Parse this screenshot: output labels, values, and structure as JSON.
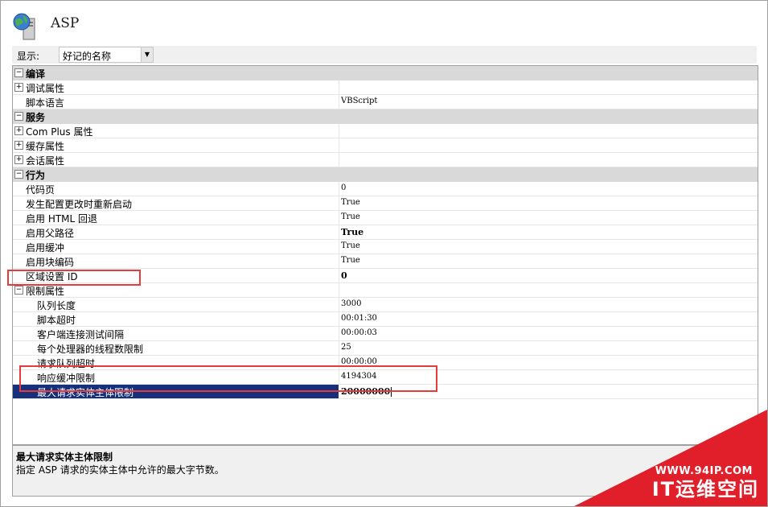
{
  "header": {
    "title": "ASP",
    "icon": "globe-server-icon"
  },
  "toolbar": {
    "show_label": "显示:",
    "show_value": "好记的名称"
  },
  "grid": {
    "categories": {
      "compile": "编译",
      "services": "服务",
      "behavior": "行为"
    },
    "rows": {
      "debug": {
        "name": "调试属性",
        "value": ""
      },
      "script_lang": {
        "name": "脚本语言",
        "value": "VBScript"
      },
      "com_plus": {
        "name": "Com Plus 属性",
        "value": ""
      },
      "cache": {
        "name": "缓存属性",
        "value": ""
      },
      "session": {
        "name": "会话属性",
        "value": ""
      },
      "code_page": {
        "name": "代码页",
        "value": "0"
      },
      "restart_on_change": {
        "name": "发生配置更改时重新启动",
        "value": "True"
      },
      "html_fallback": {
        "name": "启用 HTML 回退",
        "value": "True"
      },
      "parent_paths": {
        "name": "启用父路径",
        "value": "True"
      },
      "buffering": {
        "name": "启用缓冲",
        "value": "True"
      },
      "chunked": {
        "name": "启用块编码",
        "value": "True"
      },
      "locale_id": {
        "name": "区域设置 ID",
        "value": "0"
      },
      "limits": {
        "name": "限制属性",
        "value": ""
      },
      "queue_length": {
        "name": "队列长度",
        "value": "3000"
      },
      "script_timeout": {
        "name": "脚本超时",
        "value": "00:01:30"
      },
      "client_test_interval": {
        "name": "客户端连接测试间隔",
        "value": "00:00:03"
      },
      "threads_per_proc": {
        "name": "每个处理器的线程数限制",
        "value": "25"
      },
      "queue_timeout": {
        "name": "请求队列超时",
        "value": "00:00:00"
      },
      "buffer_limit": {
        "name": "响应缓冲限制",
        "value": "4194304"
      },
      "max_entity": {
        "name": "最大请求实体主体限制",
        "value": "20000000"
      }
    }
  },
  "description": {
    "title": "最大请求实体主体限制",
    "text": "指定 ASP 请求的实体主体中允许的最大字节数。"
  },
  "watermark": {
    "url": "WWW.94IP.COM",
    "brand": "IT运维空间"
  },
  "colors": {
    "selection": "#17307b",
    "category": "#d9d9d9",
    "highlight": "#e53b3b",
    "watermark": "#e01f2a"
  }
}
